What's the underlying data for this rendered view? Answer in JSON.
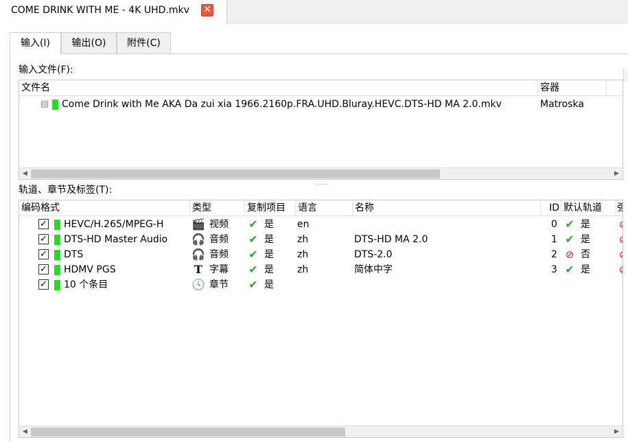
{
  "window": {
    "tab_title": "COME DRINK WITH ME - 4K UHD.mkv",
    "close_symbol": "✕"
  },
  "tabs": [
    {
      "label": "输入(I)",
      "active": true
    },
    {
      "label": "输出(O)",
      "active": false
    },
    {
      "label": "附件(C)",
      "active": false
    }
  ],
  "input_files": {
    "label": "输入文件(F):",
    "columns": [
      "文件名",
      "容器"
    ],
    "rows": [
      {
        "file_name": "Come Drink with Me AKA Da zui xia 1966.2160p.FRA.UHD.Bluray.HEVC.DTS-HD MA 2.0.mkv",
        "container": "Matroska"
      }
    ]
  },
  "tracks": {
    "label": "轨道、章节及标签(T):",
    "columns": [
      "编码格式",
      "类型",
      "复制项目",
      "语言",
      "名称",
      "ID",
      "默认轨道",
      "强"
    ],
    "rows": [
      {
        "codec": "HEVC/H.265/MPEG-H",
        "type_icon": "film-icon",
        "type": "视频",
        "copy": "是",
        "language": "en",
        "name": "",
        "id": "0",
        "default_icon": "tick",
        "default": "是"
      },
      {
        "codec": "DTS-HD Master Audio",
        "type_icon": "headphones-icon",
        "type": "音频",
        "copy": "是",
        "language": "zh",
        "name": "DTS-HD MA 2.0",
        "id": "1",
        "default_icon": "tick",
        "default": "是"
      },
      {
        "codec": "DTS",
        "type_icon": "headphones-icon",
        "type": "音频",
        "copy": "是",
        "language": "zh",
        "name": "DTS-2.0",
        "id": "2",
        "default_icon": "no",
        "default": "否"
      },
      {
        "codec": "HDMV PGS",
        "type_icon": "text-icon",
        "type": "字幕",
        "copy": "是",
        "language": "zh",
        "name": "简体中字",
        "id": "3",
        "default_icon": "tick",
        "default": "是"
      },
      {
        "codec": "10 个条目",
        "type_icon": "clock-icon",
        "type": "章节",
        "copy": "是",
        "language": "",
        "name": "",
        "id": "",
        "default_icon": "",
        "default": ""
      }
    ]
  },
  "colors": {
    "track_indicator": "#22dd22",
    "tick": "#2fa52f",
    "close_button": "#e8583a"
  }
}
